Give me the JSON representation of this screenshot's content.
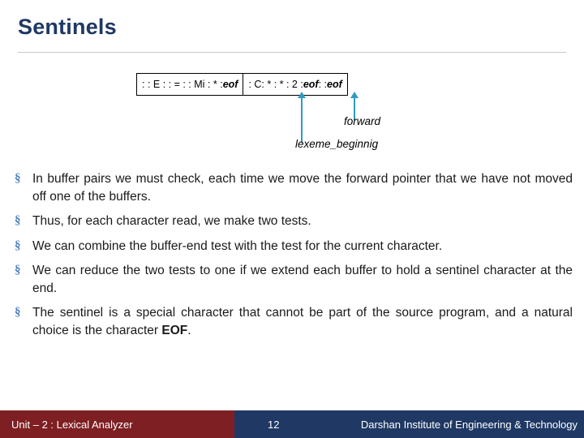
{
  "slide": {
    "title": "Sentinels",
    "diagram": {
      "buffer1": ": : E : : = : : Mi : * : eof",
      "buffer1_plain_prefix": ": : E : : = : : Mi : * : ",
      "buffer1_italic": "eof",
      "buffer2_plain_prefix": ": C: * : * : 2 : ",
      "buffer2_italic_1": "eof",
      "buffer2_middle": " : : ",
      "buffer2_italic_2": "eof",
      "label_forward": "forward",
      "label_lexeme": "lexeme_beginnig",
      "arrow_color": "#2e9bbf"
    },
    "bullets": [
      {
        "mark": "§",
        "text": "In buffer pairs we must check, each time we move the forward pointer that we have not moved off one of the buffers."
      },
      {
        "mark": "§",
        "text": "Thus, for each character read, we make two tests."
      },
      {
        "mark": "§",
        "text": "We can combine the buffer-end test with the test for the current character."
      },
      {
        "mark": "§",
        "text": "We can reduce the two tests to one if we extend each buffer to hold a sentinel character at the end."
      },
      {
        "mark": "§",
        "text_pre": "The sentinel is a special character that cannot be part of the source program, and a natural choice is the character ",
        "text_bold": "EOF",
        "text_post": "."
      }
    ],
    "footer": {
      "left": "Unit – 2 : Lexical Analyzer",
      "page": "12",
      "right": "Darshan Institute of Engineering & Technology",
      "left_bg": "#7e1f23",
      "right_bg": "#1f3864"
    }
  }
}
